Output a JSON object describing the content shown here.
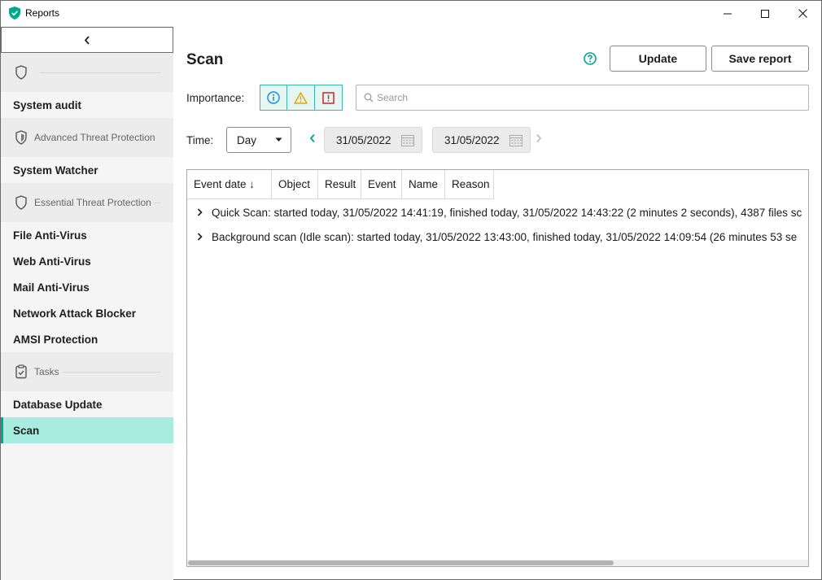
{
  "window": {
    "title": "Reports",
    "app_icon": "kaspersky-shield-icon"
  },
  "sidebar": {
    "collapse_icon": "chevron-left-icon",
    "groups": [
      {
        "label": "",
        "icon": "shield-icon"
      },
      {
        "label": "Advanced Threat Protection",
        "icon": "shield-icon"
      },
      {
        "label": "Essential Threat Protection",
        "icon": "shield-icon"
      },
      {
        "label": "Tasks",
        "icon": "clipboard-check-icon"
      }
    ],
    "items": [
      {
        "label": "System audit"
      },
      {
        "label": "System Watcher"
      },
      {
        "label": "File Anti-Virus"
      },
      {
        "label": "Web Anti-Virus"
      },
      {
        "label": "Mail Anti-Virus"
      },
      {
        "label": "Network Attack Blocker"
      },
      {
        "label": "AMSI Protection"
      },
      {
        "label": "Database Update"
      },
      {
        "label": "Scan"
      }
    ],
    "active_item": "Scan"
  },
  "main": {
    "title": "Scan",
    "update_label": "Update",
    "save_label": "Save report",
    "importance_label": "Importance:",
    "importance_buttons": [
      "info-icon",
      "warning-icon",
      "critical-icon"
    ],
    "search_placeholder": "Search",
    "time_label": "Time:",
    "time_period": "Day",
    "date_from": "31/05/2022",
    "date_to": "31/05/2022"
  },
  "table": {
    "columns": [
      "Event date ↓",
      "Object",
      "Result",
      "Event",
      "Name",
      "Reason"
    ],
    "rows": [
      {
        "text": "Quick Scan: started today, 31/05/2022 14:41:19, finished today, 31/05/2022 14:43:22 (2 minutes 2 seconds), 4387 files sc"
      },
      {
        "text": "Background scan (Idle scan): started today, 31/05/2022 13:43:00, finished today, 31/05/2022 14:09:54 (26 minutes 53 se"
      }
    ]
  },
  "colors": {
    "accent": "#00a88e",
    "active_bg": "#a8ece0",
    "info": "#1f8fd6",
    "warning": "#e0a800",
    "critical": "#d0202c"
  }
}
